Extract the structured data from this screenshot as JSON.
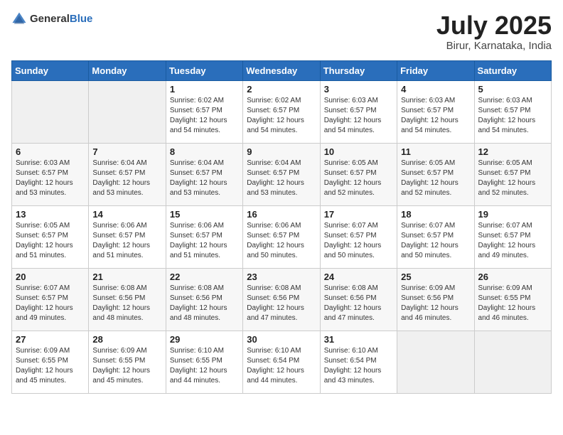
{
  "logo": {
    "general": "General",
    "blue": "Blue"
  },
  "header": {
    "month": "July 2025",
    "location": "Birur, Karnataka, India"
  },
  "weekdays": [
    "Sunday",
    "Monday",
    "Tuesday",
    "Wednesday",
    "Thursday",
    "Friday",
    "Saturday"
  ],
  "weeks": [
    [
      {
        "day": "",
        "info": ""
      },
      {
        "day": "",
        "info": ""
      },
      {
        "day": "1",
        "info": "Sunrise: 6:02 AM\nSunset: 6:57 PM\nDaylight: 12 hours and 54 minutes."
      },
      {
        "day": "2",
        "info": "Sunrise: 6:02 AM\nSunset: 6:57 PM\nDaylight: 12 hours and 54 minutes."
      },
      {
        "day": "3",
        "info": "Sunrise: 6:03 AM\nSunset: 6:57 PM\nDaylight: 12 hours and 54 minutes."
      },
      {
        "day": "4",
        "info": "Sunrise: 6:03 AM\nSunset: 6:57 PM\nDaylight: 12 hours and 54 minutes."
      },
      {
        "day": "5",
        "info": "Sunrise: 6:03 AM\nSunset: 6:57 PM\nDaylight: 12 hours and 54 minutes."
      }
    ],
    [
      {
        "day": "6",
        "info": "Sunrise: 6:03 AM\nSunset: 6:57 PM\nDaylight: 12 hours and 53 minutes."
      },
      {
        "day": "7",
        "info": "Sunrise: 6:04 AM\nSunset: 6:57 PM\nDaylight: 12 hours and 53 minutes."
      },
      {
        "day": "8",
        "info": "Sunrise: 6:04 AM\nSunset: 6:57 PM\nDaylight: 12 hours and 53 minutes."
      },
      {
        "day": "9",
        "info": "Sunrise: 6:04 AM\nSunset: 6:57 PM\nDaylight: 12 hours and 53 minutes."
      },
      {
        "day": "10",
        "info": "Sunrise: 6:05 AM\nSunset: 6:57 PM\nDaylight: 12 hours and 52 minutes."
      },
      {
        "day": "11",
        "info": "Sunrise: 6:05 AM\nSunset: 6:57 PM\nDaylight: 12 hours and 52 minutes."
      },
      {
        "day": "12",
        "info": "Sunrise: 6:05 AM\nSunset: 6:57 PM\nDaylight: 12 hours and 52 minutes."
      }
    ],
    [
      {
        "day": "13",
        "info": "Sunrise: 6:05 AM\nSunset: 6:57 PM\nDaylight: 12 hours and 51 minutes."
      },
      {
        "day": "14",
        "info": "Sunrise: 6:06 AM\nSunset: 6:57 PM\nDaylight: 12 hours and 51 minutes."
      },
      {
        "day": "15",
        "info": "Sunrise: 6:06 AM\nSunset: 6:57 PM\nDaylight: 12 hours and 51 minutes."
      },
      {
        "day": "16",
        "info": "Sunrise: 6:06 AM\nSunset: 6:57 PM\nDaylight: 12 hours and 50 minutes."
      },
      {
        "day": "17",
        "info": "Sunrise: 6:07 AM\nSunset: 6:57 PM\nDaylight: 12 hours and 50 minutes."
      },
      {
        "day": "18",
        "info": "Sunrise: 6:07 AM\nSunset: 6:57 PM\nDaylight: 12 hours and 50 minutes."
      },
      {
        "day": "19",
        "info": "Sunrise: 6:07 AM\nSunset: 6:57 PM\nDaylight: 12 hours and 49 minutes."
      }
    ],
    [
      {
        "day": "20",
        "info": "Sunrise: 6:07 AM\nSunset: 6:57 PM\nDaylight: 12 hours and 49 minutes."
      },
      {
        "day": "21",
        "info": "Sunrise: 6:08 AM\nSunset: 6:56 PM\nDaylight: 12 hours and 48 minutes."
      },
      {
        "day": "22",
        "info": "Sunrise: 6:08 AM\nSunset: 6:56 PM\nDaylight: 12 hours and 48 minutes."
      },
      {
        "day": "23",
        "info": "Sunrise: 6:08 AM\nSunset: 6:56 PM\nDaylight: 12 hours and 47 minutes."
      },
      {
        "day": "24",
        "info": "Sunrise: 6:08 AM\nSunset: 6:56 PM\nDaylight: 12 hours and 47 minutes."
      },
      {
        "day": "25",
        "info": "Sunrise: 6:09 AM\nSunset: 6:56 PM\nDaylight: 12 hours and 46 minutes."
      },
      {
        "day": "26",
        "info": "Sunrise: 6:09 AM\nSunset: 6:55 PM\nDaylight: 12 hours and 46 minutes."
      }
    ],
    [
      {
        "day": "27",
        "info": "Sunrise: 6:09 AM\nSunset: 6:55 PM\nDaylight: 12 hours and 45 minutes."
      },
      {
        "day": "28",
        "info": "Sunrise: 6:09 AM\nSunset: 6:55 PM\nDaylight: 12 hours and 45 minutes."
      },
      {
        "day": "29",
        "info": "Sunrise: 6:10 AM\nSunset: 6:55 PM\nDaylight: 12 hours and 44 minutes."
      },
      {
        "day": "30",
        "info": "Sunrise: 6:10 AM\nSunset: 6:54 PM\nDaylight: 12 hours and 44 minutes."
      },
      {
        "day": "31",
        "info": "Sunrise: 6:10 AM\nSunset: 6:54 PM\nDaylight: 12 hours and 43 minutes."
      },
      {
        "day": "",
        "info": ""
      },
      {
        "day": "",
        "info": ""
      }
    ]
  ]
}
